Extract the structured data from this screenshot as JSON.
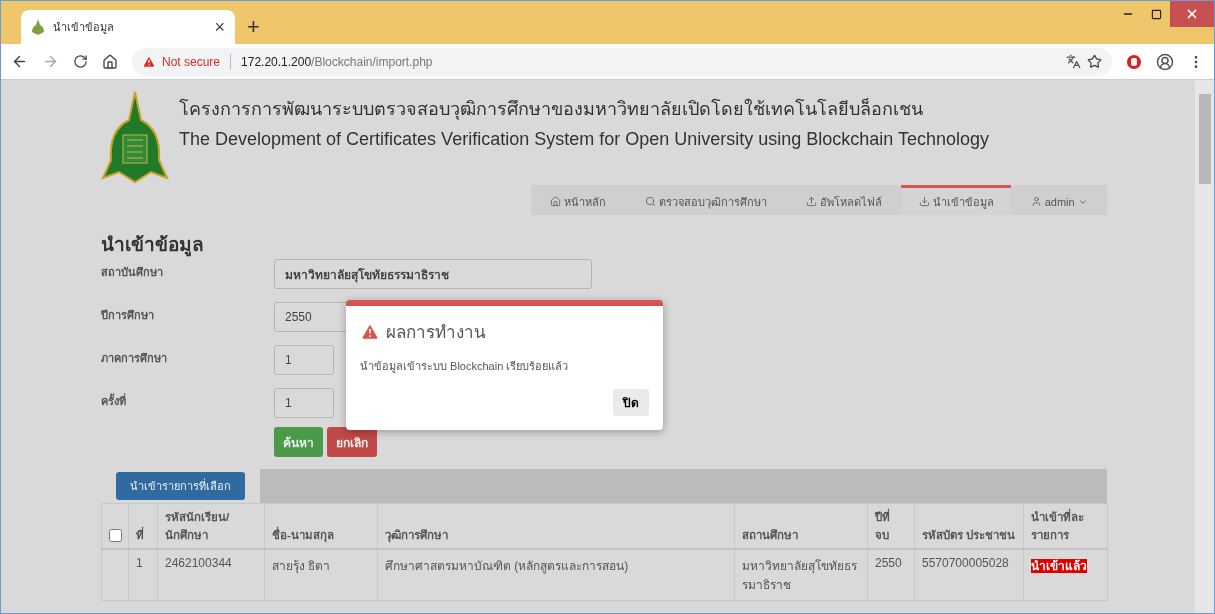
{
  "browser": {
    "tab_title": "นำเข้าข้อมูล",
    "close_tab": "×",
    "new_tab": "+",
    "security": "Not secure",
    "url_host": "172.20.1.200",
    "url_path": "/Blockchain/import.php"
  },
  "header": {
    "title_th": "โครงการการพัฒนาระบบตรวจสอบวุฒิการศึกษาของมหาวิทยาลัยเปิดโดยใช้เทคโนโลยีบล็อกเชน",
    "title_en": "The Development of Certificates Verification System for Open University using Blockchain Technology"
  },
  "nav": [
    {
      "label": "หน้าหลัก",
      "selected": false
    },
    {
      "label": "ตรวจสอบวุฒิการศึกษา",
      "selected": false
    },
    {
      "label": "อัพโหลดไฟล์",
      "selected": false
    },
    {
      "label": "นำเข้าข้อมูล",
      "selected": true
    },
    {
      "label": "admin",
      "selected": false
    }
  ],
  "form": {
    "heading": "นำเข้าข้อมูล",
    "fields": [
      {
        "label": "สถาบันศึกษา",
        "value": "มหาวิทยาลัยสุโขทัยธรรมาธิราช"
      },
      {
        "label": "ปีการศึกษา",
        "value": "2550"
      },
      {
        "label": "ภาคการศึกษา",
        "value": "1"
      },
      {
        "label": "ครั้งที่",
        "value": "1"
      }
    ],
    "buttons": [
      {
        "label": "ค้นหา",
        "kind": "success"
      },
      {
        "label": "ยกเลิก",
        "kind": "danger"
      }
    ]
  },
  "modal": {
    "title": "ผลการทำงาน",
    "message": "นำข้อมูลเข้าระบบ Blockchain เรียบร้อยแล้ว",
    "button": "ปิด"
  },
  "table": {
    "action_button": "นำเข้ารายการที่เลือก",
    "select_all": {
      "checked": false
    },
    "columns": [
      "ที่",
      "รหัสนักเรียน/ นักศึกษา",
      "ชื่อ-นามสกุล",
      "วุฒิการศึกษา",
      "สถานศึกษา",
      "ปีที่ จบ",
      "รหัสบัตร ประชาชน",
      "นำเข้าที่ละ รายการ"
    ],
    "rows": [
      {
        "cells": [
          "1",
          "2462100344",
          "สายรุ้ง ธิตา",
          "ศึกษาศาสตรมหาบัณฑิต (หลักสูตรและการสอน)",
          "มหาวิทยาลัยสุโขทัยธร รมาธิราช",
          "2550",
          "5570700005028"
        ],
        "status": "นำเข้าแล้ว"
      }
    ]
  }
}
